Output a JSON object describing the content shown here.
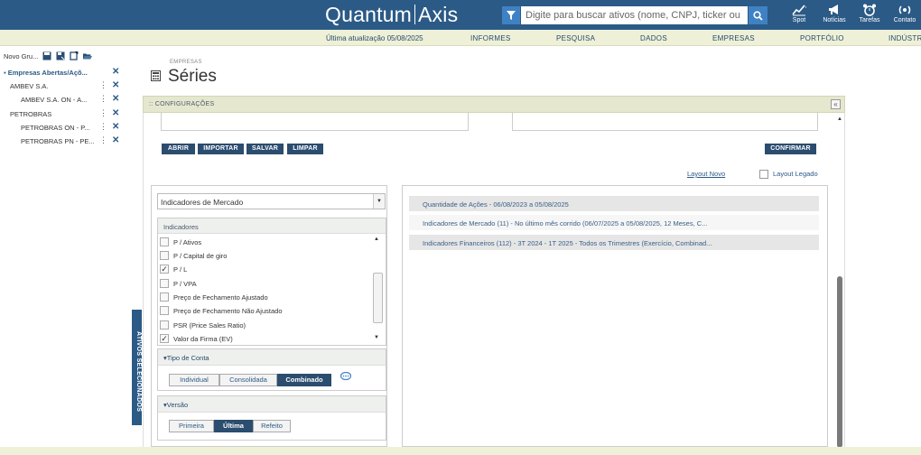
{
  "header": {
    "logo_left": "Quantum",
    "logo_right": "Axis",
    "search_placeholder": "Digite para buscar ativos (nome, CNPJ, ticker ou ...",
    "tools": [
      {
        "label": "Spot",
        "icon": "chart-icon"
      },
      {
        "label": "Notícias",
        "icon": "megaphone-icon"
      },
      {
        "label": "Tarefas",
        "icon": "alarm-clock-icon"
      },
      {
        "label": "Contato",
        "icon": "broadcast-icon"
      }
    ]
  },
  "nav": {
    "last_update": "Última atualização 05/08/2025",
    "items": [
      "INFORMES",
      "PESQUISA",
      "DADOS",
      "EMPRESAS",
      "PORTFÓLIO",
      "INDÚSTRIA"
    ]
  },
  "sidebar": {
    "new_group": "Novo Gru...",
    "tree": [
      {
        "label": "Empresas Abertas/Açõ...",
        "level": 0,
        "header": true
      },
      {
        "label": "AMBEV S.A.",
        "level": 1
      },
      {
        "label": "AMBEV S.A. ON - A...",
        "level": 2
      },
      {
        "label": "PETROBRAS",
        "level": 1
      },
      {
        "label": "PETROBRAS ON - P...",
        "level": 2
      },
      {
        "label": "PETROBRAS PN - PE...",
        "level": 2
      }
    ],
    "tab_label": "ATIVOS SELECIONADOS"
  },
  "page": {
    "breadcrumb": "EMPRESAS",
    "title": "Séries",
    "config_label": ":: CONFIGURAÇÕES"
  },
  "actions": {
    "abrir": "ABRIR",
    "importar": "IMPORTAR",
    "salvar": "SALVAR",
    "limpar": "LIMPAR",
    "confirmar": "CONFIRMAR",
    "layout_novo": "Layout Novo",
    "layout_legado": "Layout Legado"
  },
  "left_panel": {
    "selected_group": "Indicadores de Mercado",
    "indicators_header": "Indicadores",
    "indicators": [
      {
        "label": "P / Ativos",
        "checked": false
      },
      {
        "label": "P / Capital de giro",
        "checked": false
      },
      {
        "label": "P / L",
        "checked": true
      },
      {
        "label": "P / VPA",
        "checked": false
      },
      {
        "label": "Preço de Fechamento Ajustado",
        "checked": false
      },
      {
        "label": "Preço de Fechamento Não Ajustado",
        "checked": false
      },
      {
        "label": "PSR (Price Sales Ratio)",
        "checked": false
      },
      {
        "label": "Valor da Firma (EV)",
        "checked": true
      }
    ],
    "tipo_conta": {
      "header": "▾Tipo de Conta",
      "options": [
        "Individual",
        "Consolidada",
        "Combinado"
      ],
      "selected": "Combinado"
    },
    "versao": {
      "header": "▾Versão",
      "options": [
        "Primeira",
        "Última",
        "Refeito"
      ],
      "selected": "Última"
    }
  },
  "right_panel": {
    "rows": [
      "Quantidade de Ações - 06/08/2023 a 05/08/2025",
      "Indicadores de Mercado (11) - No último mês corrido (06/07/2025 a 05/08/2025, 12 Meses, C...",
      "Indicadores Financeiros (112) - 3T 2024 - 1T 2025 - Todos os Trimestres (Exercício, Combinad..."
    ]
  }
}
